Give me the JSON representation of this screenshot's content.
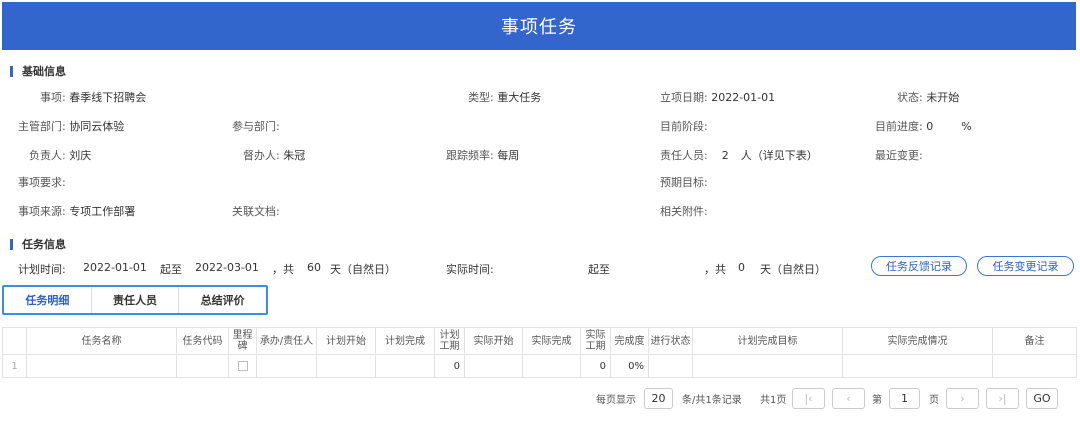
{
  "title": "事项任务",
  "basic": {
    "section_title": "基础信息",
    "item_label": "事项:",
    "item_value": "春季线下招聘会",
    "type_label": "类型:",
    "type_value": "重大任务",
    "start_label": "立项日期:",
    "start_value": "2022-01-01",
    "status_label": "状态:",
    "status_value": "未开始",
    "dept_label": "主管部门:",
    "dept_value": "协同云体验",
    "joint_label": "参与部门:",
    "joint_value": "",
    "stage_label": "目前阶段:",
    "stage_value": "",
    "progress_label": "目前进度:",
    "progress_value": "0",
    "progress_unit": "%",
    "owner_label": "负责人:",
    "owner_value": "刘庆",
    "super_label": "督办人:",
    "super_value": "朱冠",
    "freq_label": "跟踪频率:",
    "freq_value": "每周",
    "resp_label": "责任人员:",
    "resp_value": "2",
    "resp_suffix": "人（详见下表）",
    "change_label": "最近变更:",
    "change_value": "",
    "req_label": "事项要求:",
    "req_value": "",
    "goal_label": "预期目标:",
    "goal_value": "",
    "source_label": "事项来源:",
    "source_value": "专项工作部署",
    "docs_label": "关联文档:",
    "docs_value": "",
    "attach_label": "相关附件:",
    "attach_value": ""
  },
  "task": {
    "section_title": "任务信息",
    "plan_label": "计划时间:",
    "plan_start": "2022-01-01",
    "from_word": "起至",
    "plan_end": "2022-03-01",
    "total_prefix": "，共",
    "plan_days": "60",
    "days_suffix": "天（自然日）",
    "actual_label": "实际时间:",
    "actual_from_word": "起至",
    "actual_total_prefix": "，共",
    "actual_days": "0",
    "actual_days_suffix": "天（自然日）",
    "feedback_button": "任务反馈记录",
    "change_button": "任务变更记录"
  },
  "tabs": [
    "任务明细",
    "责任人员",
    "总结评价"
  ],
  "table": {
    "headers": [
      "",
      "任务名称",
      "任务代码",
      "里程碑",
      "承办/责任人",
      "计划开始",
      "计划完成",
      "计划工期",
      "实际开始",
      "实际完成",
      "实际工期",
      "完成度",
      "进行状态",
      "计划完成目标",
      "实际完成情况",
      "备注"
    ],
    "rows": [
      {
        "index": "1",
        "name": "",
        "code": "",
        "plan_days": "0",
        "actual_days": "0",
        "completion": "0%",
        "state": ""
      }
    ]
  },
  "pager": {
    "per_page_label": "每页显示",
    "per_page_value": "20",
    "records_text": "条/共1条记录",
    "pages_text": "共1页",
    "page_prefix": "第",
    "page_value": "1",
    "page_suffix": "页",
    "go_label": "GO"
  },
  "colors": {
    "header": "#3366cc",
    "accent": "#2a62c8",
    "tab_border": "#3a8ee6"
  }
}
